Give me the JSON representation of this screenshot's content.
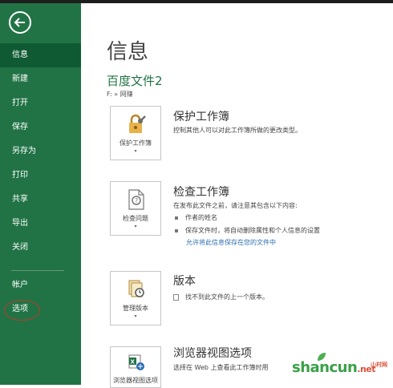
{
  "sidebar": {
    "items": [
      {
        "label": "信息"
      },
      {
        "label": "新建"
      },
      {
        "label": "打开"
      },
      {
        "label": "保存"
      },
      {
        "label": "另存为"
      },
      {
        "label": "打印"
      },
      {
        "label": "共享"
      },
      {
        "label": "导出"
      },
      {
        "label": "关闭"
      },
      {
        "label": "帐户"
      },
      {
        "label": "选项"
      }
    ],
    "active": "信息"
  },
  "main": {
    "title": "信息",
    "doc_name": "百度文件2",
    "doc_path": "F: » 网赚",
    "sections": [
      {
        "tile_label": "保护工作簿",
        "title": "保护工作簿",
        "description": "控制其他人可以对此工作簿所做的更改类型。"
      },
      {
        "tile_label": "检查问题",
        "title": "检查工作簿",
        "description": "在发布此文件之前，请注意其包含以下内容:",
        "bullets": [
          "作者的姓名",
          "保存文件时，将自动删除属性和个人信息的设置"
        ],
        "link": "允许将此信息保存在您的文件中"
      },
      {
        "tile_label": "管理版本",
        "title": "版本",
        "description": "找不到此文件的上一个版本。"
      },
      {
        "tile_label": "浏览器视图选项",
        "title": "浏览器视图选项",
        "description": "选择在 Web 上查看此工作簿时用"
      }
    ]
  },
  "watermark": {
    "text": "shancun",
    "suffix": ".net",
    "cn": "山村网"
  },
  "colors": {
    "sidebar": "#217346",
    "active_item": "#0f5a33",
    "accent": "#217346",
    "link": "#2b6cb0",
    "highlight": "#c0392b"
  }
}
